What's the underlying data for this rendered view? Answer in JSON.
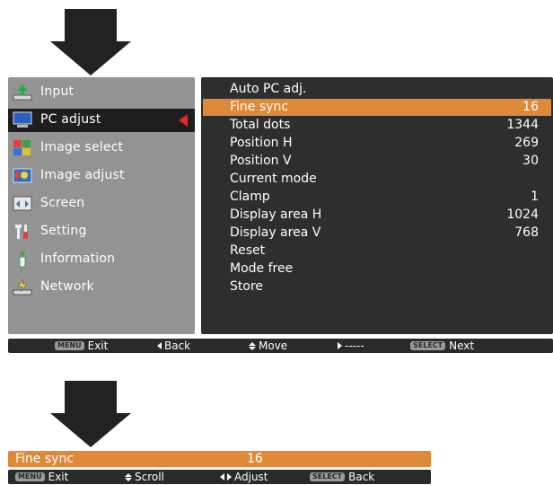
{
  "left_menu": {
    "items": [
      {
        "label": "Input",
        "icon": "input-icon"
      },
      {
        "label": "PC adjust",
        "icon": "pc-adjust-icon",
        "selected": true
      },
      {
        "label": "Image select",
        "icon": "image-select-icon"
      },
      {
        "label": "Image adjust",
        "icon": "image-adjust-icon"
      },
      {
        "label": "Screen",
        "icon": "screen-icon"
      },
      {
        "label": "Setting",
        "icon": "setting-icon"
      },
      {
        "label": "Information",
        "icon": "information-icon"
      },
      {
        "label": "Network",
        "icon": "network-icon"
      }
    ]
  },
  "submenu": {
    "items": [
      {
        "label": "Auto PC adj.",
        "value": ""
      },
      {
        "label": "Fine sync",
        "value": "16",
        "highlight": true
      },
      {
        "label": "Total dots",
        "value": "1344"
      },
      {
        "label": "Position H",
        "value": "269"
      },
      {
        "label": "Position V",
        "value": "30"
      },
      {
        "label": "Current mode",
        "value": ""
      },
      {
        "label": "Clamp",
        "value": "1"
      },
      {
        "label": "Display area H",
        "value": "1024"
      },
      {
        "label": "Display area V",
        "value": "768"
      },
      {
        "label": "Reset",
        "value": ""
      },
      {
        "label": "Mode free",
        "value": ""
      },
      {
        "label": "Store",
        "value": ""
      }
    ]
  },
  "guide_top": {
    "menu_key": "MENU",
    "exit": "Exit",
    "back": "Back",
    "move": "Move",
    "dashes": "-----",
    "select_key": "SELECT",
    "next": "Next"
  },
  "adjust_bar": {
    "label": "Fine sync",
    "value": "16"
  },
  "guide_bottom": {
    "menu_key": "MENU",
    "exit": "Exit",
    "scroll": "Scroll",
    "adjust": "Adjust",
    "select_key": "SELECT",
    "back": "Back"
  },
  "colors": {
    "highlight": "#df8a3a",
    "panel_dark": "#2e2e2e",
    "panel_gray": "#939393",
    "selection_marker": "#e3262d"
  }
}
